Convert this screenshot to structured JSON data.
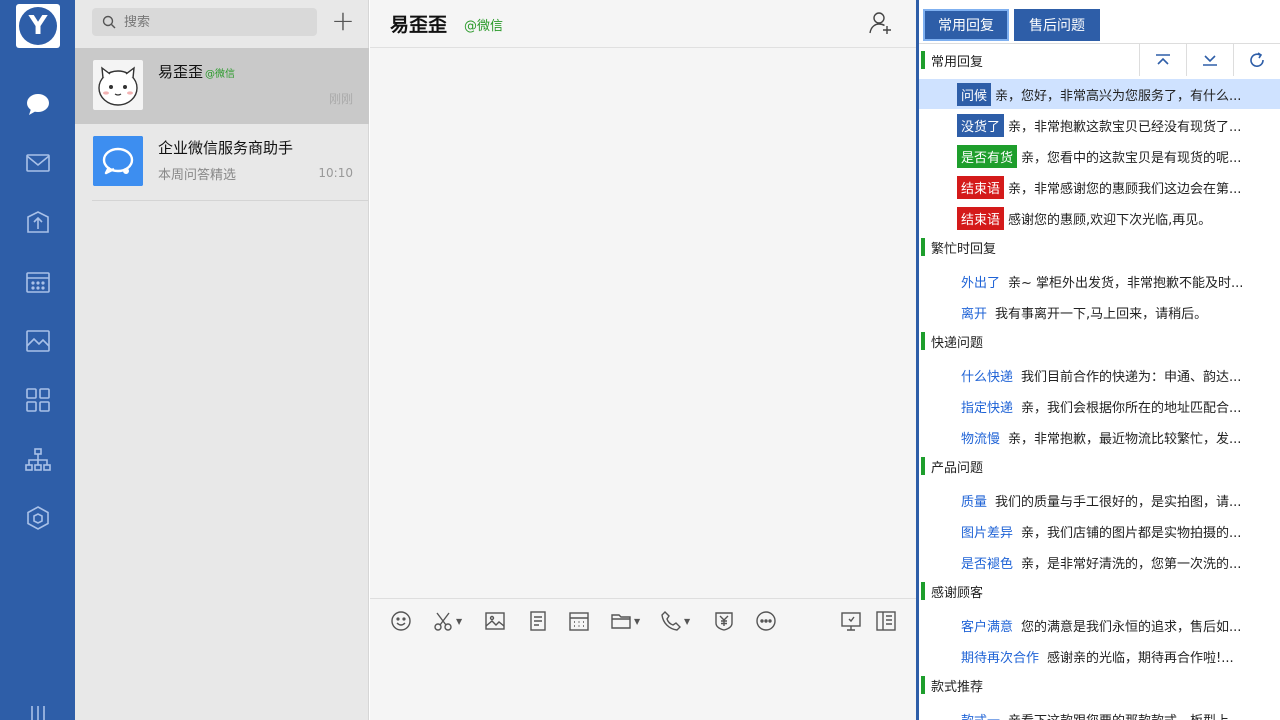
{
  "colors": {
    "primary": "#2e5ea8",
    "wechat_green": "#2a9a2a",
    "section_bar": "#1e9e2c",
    "pill_blue": "#2e5ea8",
    "pill_green": "#1e9e2c",
    "pill_red": "#d41a1a",
    "link_blue": "#1f63d6",
    "highlight_row": "#cfe2ff"
  },
  "rail": {
    "logo_letter": "Y",
    "icons": [
      "chat-icon",
      "mail-icon",
      "box-icon",
      "calendar-icon",
      "gallery-icon",
      "apps-icon",
      "org-icon",
      "cube-icon",
      "settings-icon"
    ]
  },
  "conversations": {
    "search_placeholder": "搜索",
    "items": [
      {
        "name": "易歪歪",
        "tag": "@微信",
        "preview": "",
        "time": "刚刚"
      },
      {
        "name": "企业微信服务商助手",
        "tag": "",
        "preview": "本周问答精选",
        "time": "10:10"
      }
    ]
  },
  "chat": {
    "title": "易歪歪",
    "title_tag": "@微信",
    "toolbar_icons": [
      "emoji-icon",
      "scissors-icon",
      "image-icon",
      "file-icon",
      "calculator-icon",
      "folder-icon",
      "phone-icon",
      "payment-icon",
      "more-icon",
      "screen-icon",
      "panel-icon"
    ]
  },
  "panel": {
    "tabs": [
      {
        "label": "常用回复",
        "active": true
      },
      {
        "label": "售后问题",
        "active": false
      }
    ],
    "sections": [
      {
        "title": "常用回复",
        "rows": [
          {
            "key": "问候",
            "style": "pill",
            "color": "#2e5ea8",
            "text": "亲，您好，非常高兴为您服务了，有什么..."
          },
          {
            "key": "没货了",
            "style": "pill",
            "color": "#2e5ea8",
            "text": "亲，非常抱歉这款宝贝已经没有现货了..."
          },
          {
            "key": "是否有货",
            "style": "pill",
            "color": "#1e9e2c",
            "text": "亲，您看中的这款宝贝是有现货的呢..."
          },
          {
            "key": "结束语",
            "style": "pill",
            "color": "#d41a1a",
            "text": "亲，非常感谢您的惠顾我们这边会在第..."
          },
          {
            "key": "结束语",
            "style": "pill",
            "color": "#d41a1a",
            "text": "感谢您的惠顾,欢迎下次光临,再见。"
          }
        ]
      },
      {
        "title": "繁忙时回复",
        "rows": [
          {
            "key": "外出了",
            "style": "link",
            "text": "亲~ 掌柜外出发货，非常抱歉不能及时..."
          },
          {
            "key": "离开",
            "style": "link",
            "text": "我有事离开一下,马上回来，请稍后。"
          }
        ]
      },
      {
        "title": "快递问题",
        "rows": [
          {
            "key": "什么快递",
            "style": "link",
            "text": "我们目前合作的快递为：申通、韵达..."
          },
          {
            "key": "指定快递",
            "style": "link",
            "text": "亲，我们会根据你所在的地址匹配合..."
          },
          {
            "key": "物流慢",
            "style": "link",
            "text": "亲，非常抱歉，最近物流比较繁忙，发..."
          }
        ]
      },
      {
        "title": "产品问题",
        "rows": [
          {
            "key": "质量",
            "style": "link",
            "text": "我们的质量与手工很好的，是实拍图，请..."
          },
          {
            "key": "图片差异",
            "style": "link",
            "text": "亲，我们店铺的图片都是实物拍摄的..."
          },
          {
            "key": "是否褪色",
            "style": "link",
            "text": "亲，是非常好清洗的，您第一次洗的..."
          }
        ]
      },
      {
        "title": "感谢顾客",
        "rows": [
          {
            "key": "客户满意",
            "style": "link",
            "text": "您的满意是我们永恒的追求，售后如..."
          },
          {
            "key": "期待再次合作",
            "style": "link",
            "text": "感谢亲的光临，期待再合作啦!..."
          }
        ]
      },
      {
        "title": "款式推荐",
        "rows": [
          {
            "key": "款式一",
            "style": "link",
            "text": "亲看下这款跟您要的那款款式，板型上..."
          }
        ]
      }
    ],
    "section_icons": [
      "collapse-all-icon",
      "expand-all-icon",
      "refresh-icon"
    ]
  }
}
